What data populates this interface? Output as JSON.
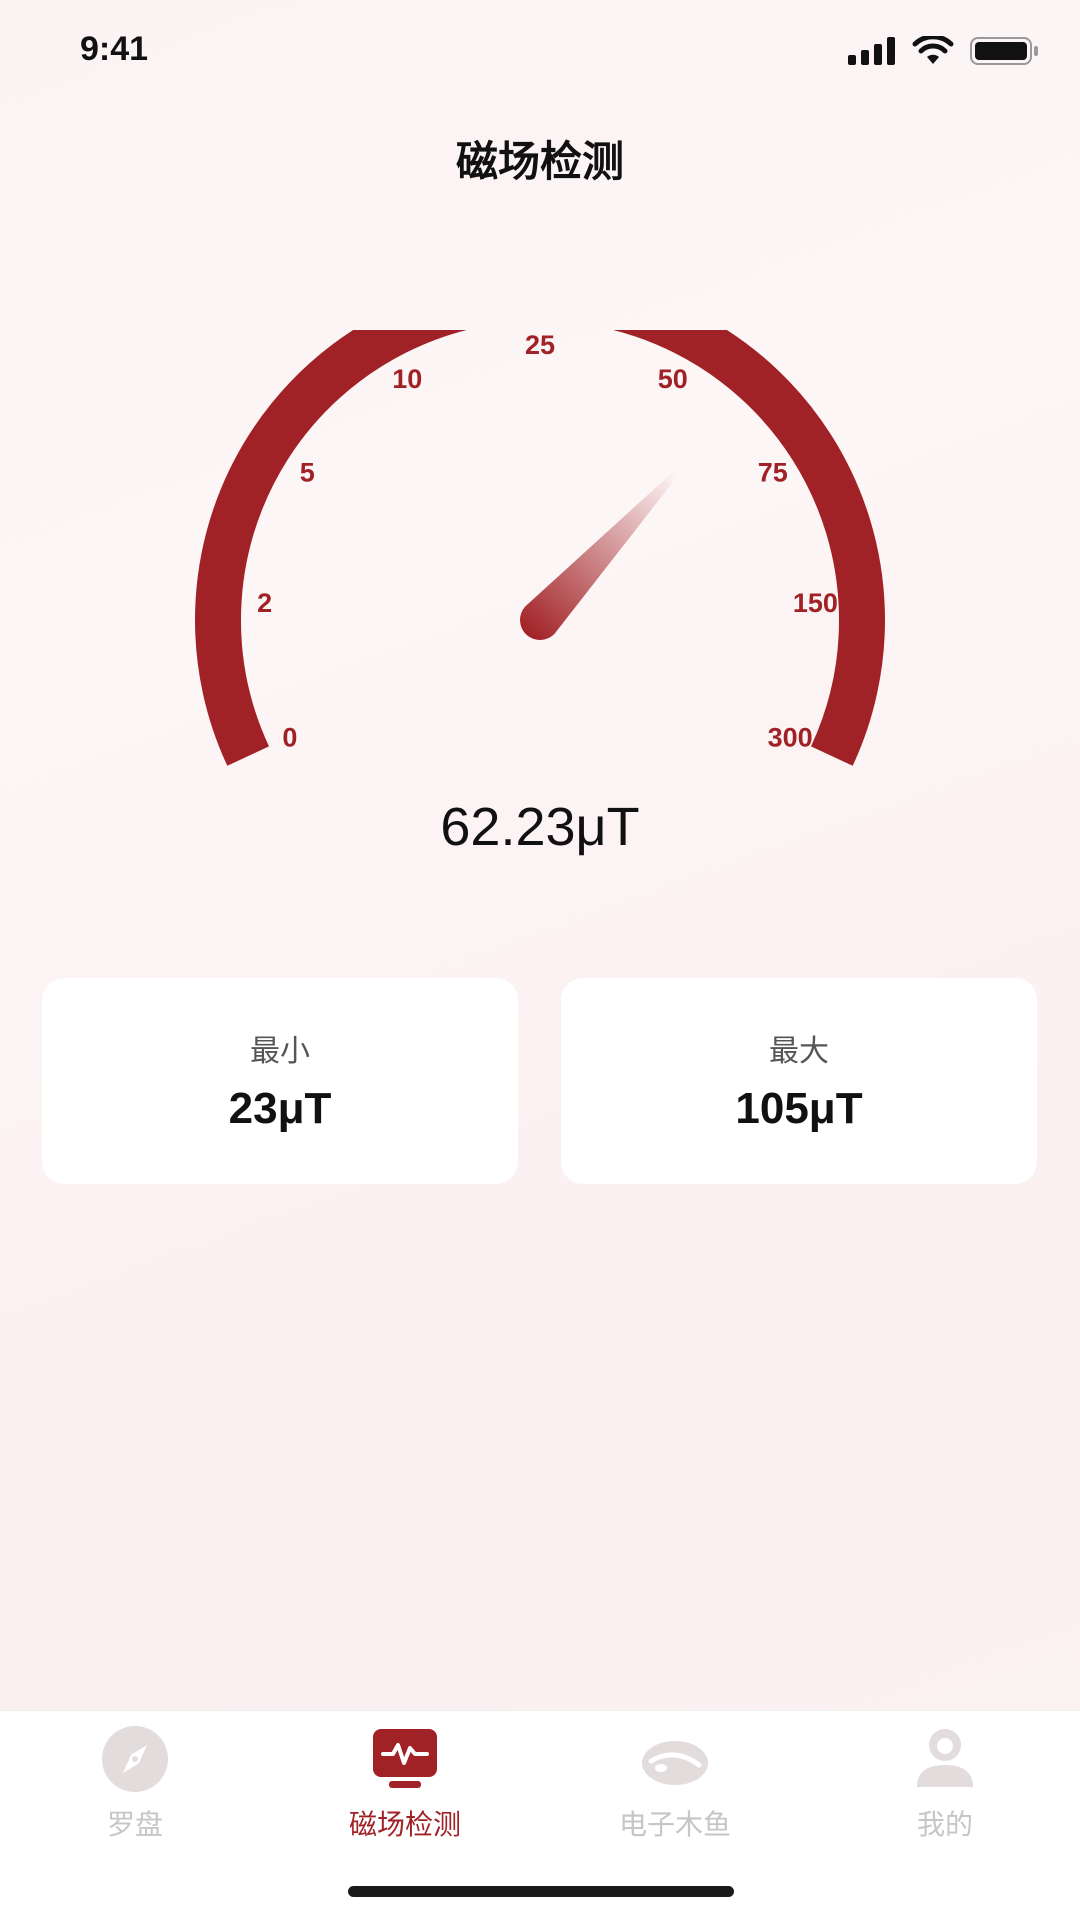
{
  "status_bar": {
    "time": "9:41"
  },
  "page_title": "磁场检测",
  "colors": {
    "accent": "#a12226",
    "inactive": "#c6c6c6",
    "card_bg": "#ffffff"
  },
  "gauge": {
    "ticks": [
      "0",
      "2",
      "5",
      "10",
      "25",
      "50",
      "75",
      "150",
      "300"
    ],
    "needle_value_uT": 62.23,
    "reading": "62.23μT"
  },
  "stats": {
    "min_label": "最小",
    "min_value": "23μT",
    "max_label": "最大",
    "max_value": "105μT"
  },
  "tabs": [
    {
      "label": "罗盘",
      "icon": "compass-icon",
      "active": false
    },
    {
      "label": "磁场检测",
      "icon": "pulse-monitor-icon",
      "active": true
    },
    {
      "label": "电子木鱼",
      "icon": "wooden-fish-icon",
      "active": false
    },
    {
      "label": "我的",
      "icon": "user-icon",
      "active": false
    }
  ]
}
